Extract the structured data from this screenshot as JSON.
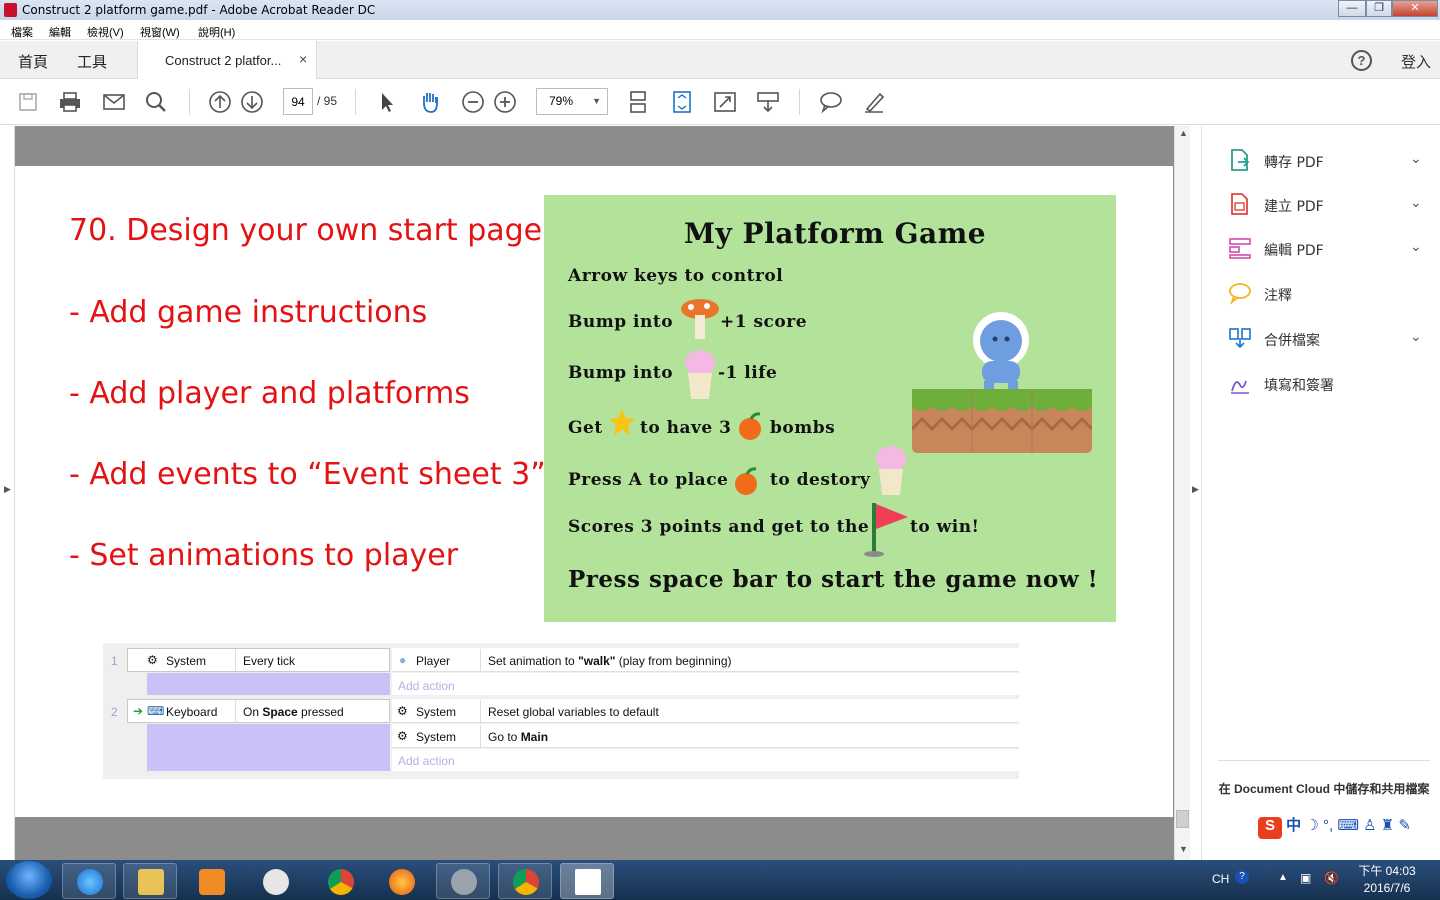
{
  "window": {
    "title": "Construct 2 platform game.pdf - Adobe Acrobat Reader DC",
    "min": "—",
    "max": "❐",
    "close": "✕"
  },
  "menu": [
    "檔案",
    "編輯",
    "檢視(V)",
    "視窗(W)",
    "說明(H)"
  ],
  "tabs": {
    "home": "首頁",
    "tools": "工具",
    "doc": "Construct 2 platfor...",
    "close": "×",
    "signin": "登入",
    "help": "?"
  },
  "toolbar": {
    "page_current": "94",
    "page_total": "/ 95",
    "zoom": "79%"
  },
  "doc": {
    "bullets": [
      "70. Design your own start page",
      "- Add game instructions",
      "- Add player and platforms",
      "- Add events to “Event sheet 3”",
      "- Set animations to player"
    ],
    "game": {
      "title": "My Platform Game",
      "line1": "Arrow keys to control",
      "line2a": "Bump into",
      "line2b": "+1 score",
      "line3a": "Bump into",
      "line3b": "-1 life",
      "line4a": "Get",
      "line4b": "to have 3",
      "line4c": "bombs",
      "line5a": "Press A to place",
      "line5b": "to destory",
      "line6a": "Scores 3 points and get to the",
      "line6b": "to win!",
      "line7": "Press space bar to start the game now !"
    },
    "events": {
      "e1": {
        "num": "1",
        "obj": "System",
        "cond": "Every tick",
        "aobj": "Player",
        "action_pre": "Set animation to ",
        "action_bold": "\"walk\"",
        "action_post": " (play from beginning)",
        "add": "Add action"
      },
      "e2": {
        "num": "2",
        "obj": "Keyboard",
        "cond_pre": "On ",
        "cond_bold": "Space",
        "cond_post": " pressed",
        "a1obj": "System",
        "a1": "Reset global variables to default",
        "a2obj": "System",
        "a2pre": "Go to ",
        "a2bold": "Main",
        "add": "Add action"
      }
    }
  },
  "rightpanel": {
    "items": [
      "轉存 PDF",
      "建立 PDF",
      "編輯 PDF",
      "注釋",
      "合併檔案",
      "填寫和簽署"
    ],
    "cloud": "在 Document Cloud 中儲存和共用檔案",
    "ime": "中"
  },
  "taskbar": {
    "lang": "CH",
    "time": "下午 04:03",
    "date": "2016/7/6"
  },
  "colors": {
    "bullet": "#e41212",
    "game_bg": "#b3e29b",
    "lavender": "#cbc1f6"
  }
}
